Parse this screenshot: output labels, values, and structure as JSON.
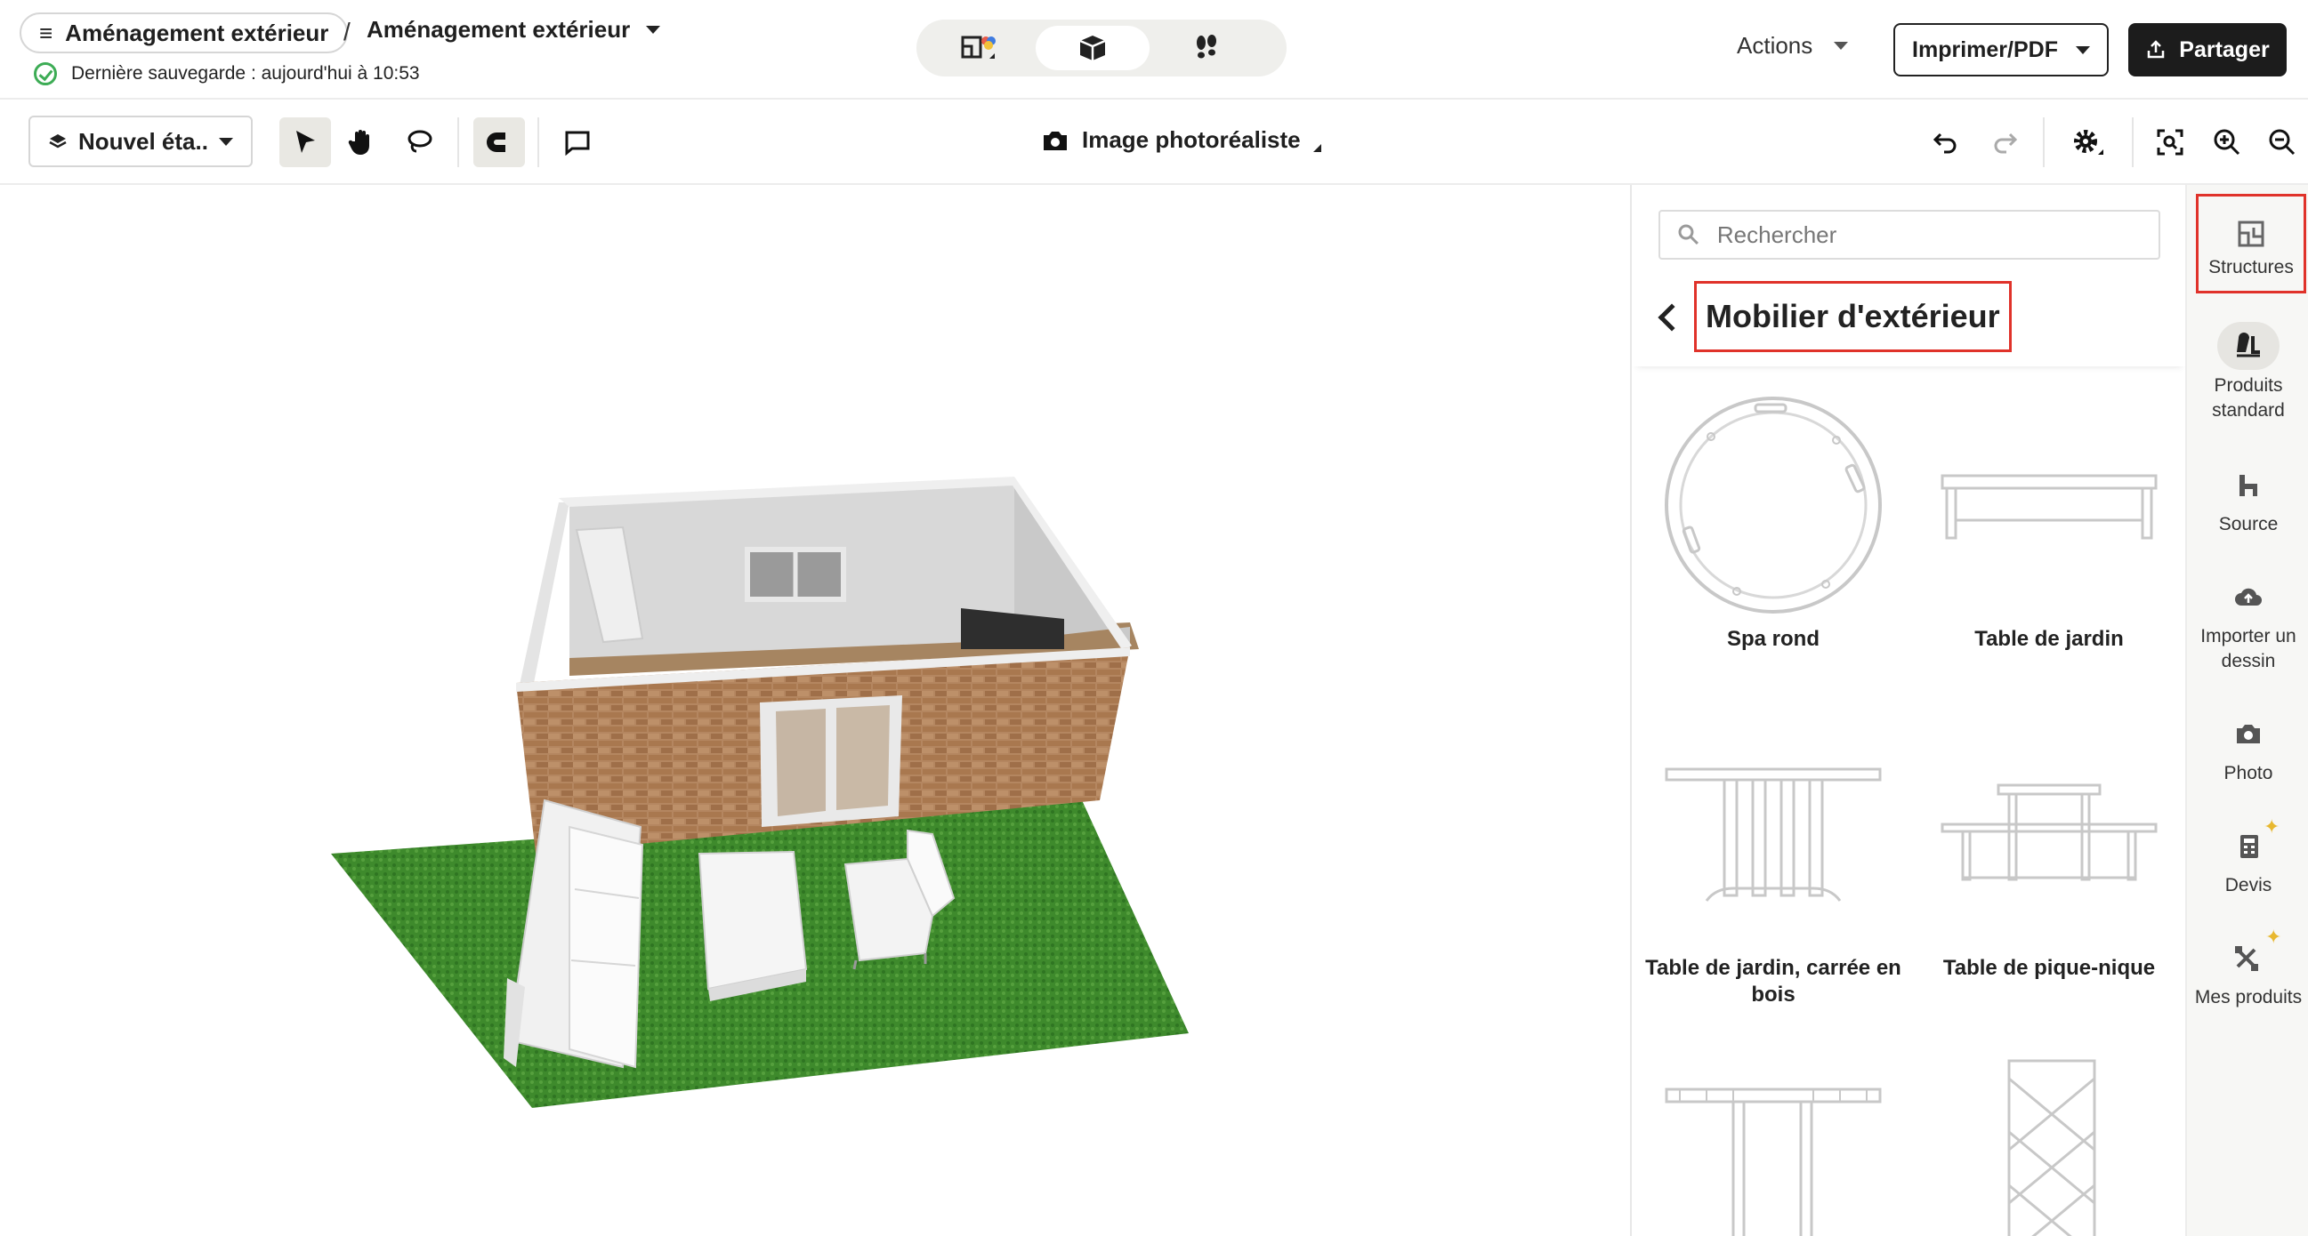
{
  "header": {
    "project_menu_label": "Aménagement extérieur",
    "breadcrumb_separator": "/",
    "project_name": "Aménagement extérieur",
    "save_status": "Dernière sauvegarde : aujourd'hui à 10:53",
    "view_modes": [
      {
        "icon": "2d-plan-icon",
        "active": false
      },
      {
        "icon": "3d-box-icon",
        "active": true
      },
      {
        "icon": "walkthrough-icon",
        "active": false
      }
    ],
    "actions_label": "Actions",
    "print_label": "Imprimer/PDF",
    "share_label": "Partager"
  },
  "toolbar": {
    "floor_label": "Nouvel éta...",
    "photo_label": "Image photoréaliste",
    "tools": [
      "select-arrow-icon",
      "pan-hand-icon",
      "lasso-icon",
      "magnet-icon",
      "comment-icon"
    ],
    "right_tools": [
      "undo-icon",
      "redo-icon",
      "settings-icon",
      "fit-view-icon",
      "zoom-in-icon",
      "zoom-out-icon"
    ]
  },
  "catalog": {
    "search_placeholder": "Rechercher",
    "category_title": "Mobilier d'extérieur",
    "items": [
      {
        "name": "Spa rond",
        "icon": "round-spa-icon"
      },
      {
        "name": "Table de jardin",
        "icon": "garden-table-icon"
      },
      {
        "name": "Table de jardin, carrée en bois",
        "icon": "square-wood-table-icon"
      },
      {
        "name": "Table de pique-nique",
        "icon": "picnic-table-icon"
      },
      {
        "name": "",
        "icon": "pergola-icon"
      },
      {
        "name": "",
        "icon": "trellis-icon"
      }
    ]
  },
  "rail": {
    "items": [
      {
        "label": "Structures",
        "icon": "structures-icon",
        "highlighted": true
      },
      {
        "label": "Produits standard",
        "icon": "standard-products-icon"
      },
      {
        "label": "Source",
        "icon": "source-icon"
      },
      {
        "label": "Importer un dessin",
        "icon": "import-drawing-icon"
      },
      {
        "label": "Photo",
        "icon": "photo-icon"
      },
      {
        "label": "Devis",
        "icon": "quote-icon"
      },
      {
        "label": "Mes produits",
        "icon": "my-products-icon"
      }
    ]
  },
  "colors": {
    "highlight": "#e0322a",
    "brick": "#b48660",
    "grass": "#3e8a2c",
    "dark": "#1c1c1c"
  }
}
